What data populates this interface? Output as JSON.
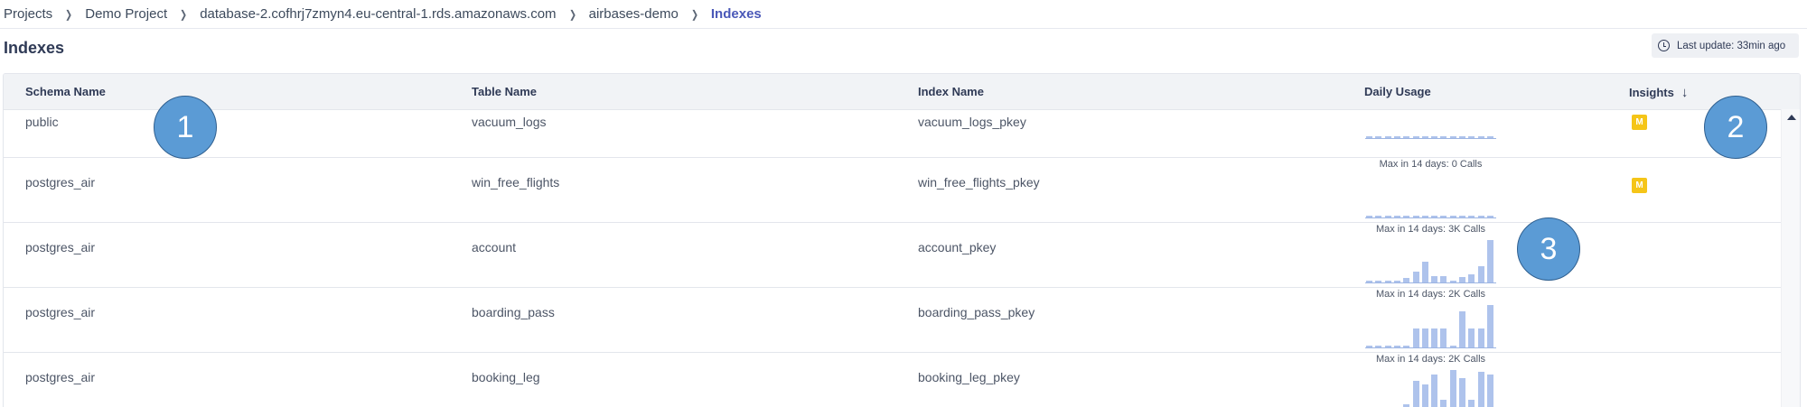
{
  "breadcrumb": [
    {
      "label": "Projects"
    },
    {
      "label": "Demo Project"
    },
    {
      "label": "database-2.cofhrj7zmyn4.eu-central-1.rds.amazonaws.com"
    },
    {
      "label": "airbases-demo"
    },
    {
      "label": "Indexes",
      "current": true
    }
  ],
  "page": {
    "title": "Indexes",
    "last_update": "Last update: 33min ago"
  },
  "table": {
    "columns": {
      "schema": "Schema Name",
      "table": "Table Name",
      "index": "Index Name",
      "usage": "Daily Usage",
      "insights": "Insights",
      "sort_icon": "arrow-down-icon"
    },
    "rows": [
      {
        "schema": "public",
        "table": "vacuum_logs",
        "index": "vacuum_logs_pkey",
        "caption": "",
        "calls": [
          0,
          0,
          0,
          0,
          0,
          0,
          0,
          0,
          0,
          0,
          0,
          0,
          0,
          0
        ],
        "insight": "M"
      },
      {
        "schema": "postgres_air",
        "table": "win_free_flights",
        "index": "win_free_flights_pkey",
        "caption": "Max in 14 days: 0 Calls",
        "calls": [
          0,
          0,
          0,
          0,
          0,
          0,
          0,
          0,
          0,
          0,
          0,
          0,
          0,
          0
        ],
        "insight": "M"
      },
      {
        "schema": "postgres_air",
        "table": "account",
        "index": "account_pkey",
        "caption": "Max in 14 days: 3K Calls",
        "calls": [
          0.05,
          0.05,
          0.05,
          0.05,
          0.1,
          0.25,
          0.48,
          0.15,
          0.15,
          0.05,
          0.13,
          0.2,
          0.38,
          1.0
        ],
        "insight": ""
      },
      {
        "schema": "postgres_air",
        "table": "boarding_pass",
        "index": "boarding_pass_pkey",
        "caption": "Max in 14 days: 2K Calls",
        "calls": [
          0.05,
          0.05,
          0.05,
          0.05,
          0.05,
          0.45,
          0.45,
          0.45,
          0.45,
          0.05,
          0.85,
          0.45,
          0.45,
          1.0
        ],
        "insight": ""
      },
      {
        "schema": "postgres_air",
        "table": "booking_leg",
        "index": "booking_leg_pkey",
        "caption": "Max in 14 days: 2K Calls",
        "calls": [
          0.05,
          0.05,
          0.05,
          0.1,
          0.2,
          0.75,
          0.65,
          0.9,
          0.3,
          1.0,
          0.8,
          0.3,
          0.95,
          0.9
        ],
        "insight": ""
      }
    ]
  },
  "markers": [
    "1",
    "2",
    "3"
  ],
  "colors": {
    "accent": "#4a58b8",
    "bar": "#aec3ec",
    "badge": "#f5c518",
    "marker": "#5b9bd5"
  }
}
